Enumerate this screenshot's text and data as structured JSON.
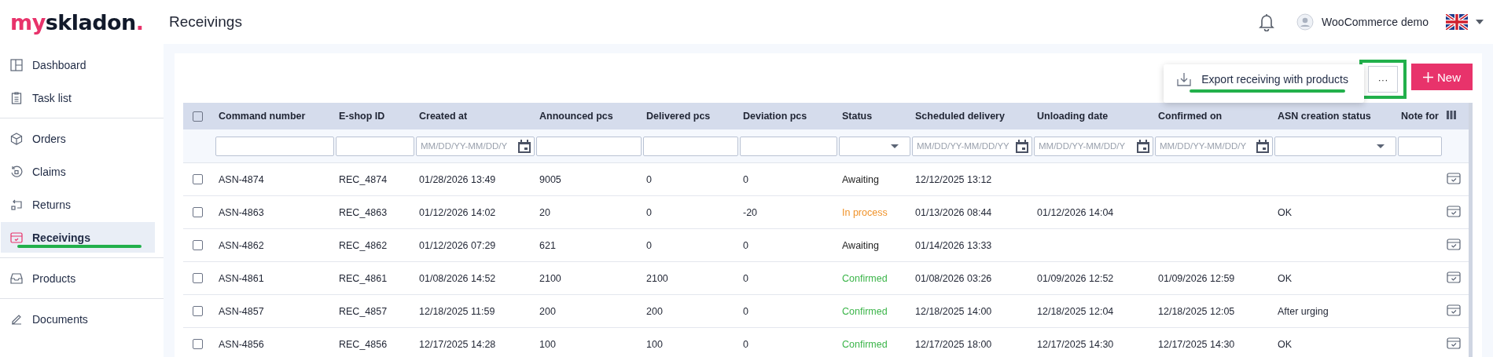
{
  "logo": {
    "parts": [
      "my",
      "skladon",
      "."
    ]
  },
  "header": {
    "page_title": "Receivings",
    "user": "WooCommerce demo"
  },
  "sidebar": {
    "groups": [
      [
        {
          "label": "Dashboard",
          "selected": false
        },
        {
          "label": "Task list",
          "selected": false
        }
      ],
      [
        {
          "label": "Orders",
          "selected": false
        },
        {
          "label": "Claims",
          "selected": false
        },
        {
          "label": "Returns",
          "selected": false
        },
        {
          "label": "Receivings",
          "selected": true
        }
      ],
      [
        {
          "label": "Products",
          "selected": false
        }
      ],
      [
        {
          "label": "Documents",
          "selected": false
        }
      ]
    ]
  },
  "toolbar": {
    "menu_items": [
      {
        "label": "Export receiving with products"
      }
    ],
    "more_button": "···",
    "new_button": "New"
  },
  "table": {
    "header_checked": false,
    "columns": [
      "Command number",
      "E-shop ID",
      "Created at",
      "Announced pcs",
      "Delivered pcs",
      "Deviation pcs",
      "Status",
      "Scheduled delivery",
      "Unloading date",
      "Confirmed on",
      "ASN creation status",
      "Note for"
    ],
    "filters": [
      {
        "kind": "text"
      },
      {
        "kind": "text"
      },
      {
        "kind": "date",
        "placeholder": "MM/DD/YY-MM/DD/Y"
      },
      {
        "kind": "text"
      },
      {
        "kind": "text"
      },
      {
        "kind": "text"
      },
      {
        "kind": "select"
      },
      {
        "kind": "date",
        "placeholder": "MM/DD/YY-MM/DD/YY"
      },
      {
        "kind": "date",
        "placeholder": "MM/DD/YY-MM/DD/Y"
      },
      {
        "kind": "date",
        "placeholder": "MM/DD/YY-MM/DD/Y"
      },
      {
        "kind": "select"
      },
      {
        "kind": "text"
      }
    ],
    "rows": [
      {
        "checked": false,
        "cells": [
          "ASN-4874",
          "REC_4874",
          "01/28/2026 13:49",
          "9005",
          "0",
          "0"
        ],
        "status": {
          "text": "Awaiting",
          "color": "#222222"
        },
        "scheduled": "12/12/2025 13:12"
      },
      {
        "checked": false,
        "cells": [
          "ASN-4863",
          "REC_4863",
          "01/12/2026 14:02",
          "20",
          "0",
          "-20"
        ],
        "status": {
          "text": "In process",
          "color": "#f0932b"
        },
        "scheduled": "01/13/2026 08:44",
        "unloading": "01/12/2026 14:04",
        "asn": "OK"
      },
      {
        "checked": false,
        "cells": [
          "ASN-4862",
          "REC_4862",
          "01/12/2026 07:29",
          "621",
          "0",
          "0"
        ],
        "status": {
          "text": "Awaiting",
          "color": "#222222"
        },
        "scheduled": "01/14/2026 13:33"
      },
      {
        "checked": false,
        "cells": [
          "ASN-4861",
          "REC_4861",
          "01/08/2026 14:52",
          "2100",
          "2100",
          "0"
        ],
        "status": {
          "text": "Confirmed",
          "color": "#3cb54a"
        },
        "scheduled": "01/08/2026 03:26",
        "unloading": "01/09/2026 12:52",
        "confirmed": "01/09/2026 12:59",
        "asn": "OK"
      },
      {
        "checked": false,
        "cells": [
          "ASN-4857",
          "REC_4857",
          "12/18/2025 11:59",
          "200",
          "200",
          "0"
        ],
        "status": {
          "text": "Confirmed",
          "color": "#3cb54a"
        },
        "scheduled": "12/18/2025 14:00",
        "unloading": "12/18/2025 12:04",
        "confirmed": "12/18/2025 12:05",
        "asn": "After urging"
      },
      {
        "checked": false,
        "cells": [
          "ASN-4856",
          "REC_4856",
          "12/17/2025 14:28",
          "100",
          "100",
          "0"
        ],
        "status": {
          "text": "Confirmed",
          "color": "#3cb54a"
        },
        "scheduled": "12/17/2025 18:00",
        "unloading": "12/17/2025 14:30",
        "confirmed": "12/17/2025 14:30",
        "asn": "OK"
      }
    ]
  }
}
